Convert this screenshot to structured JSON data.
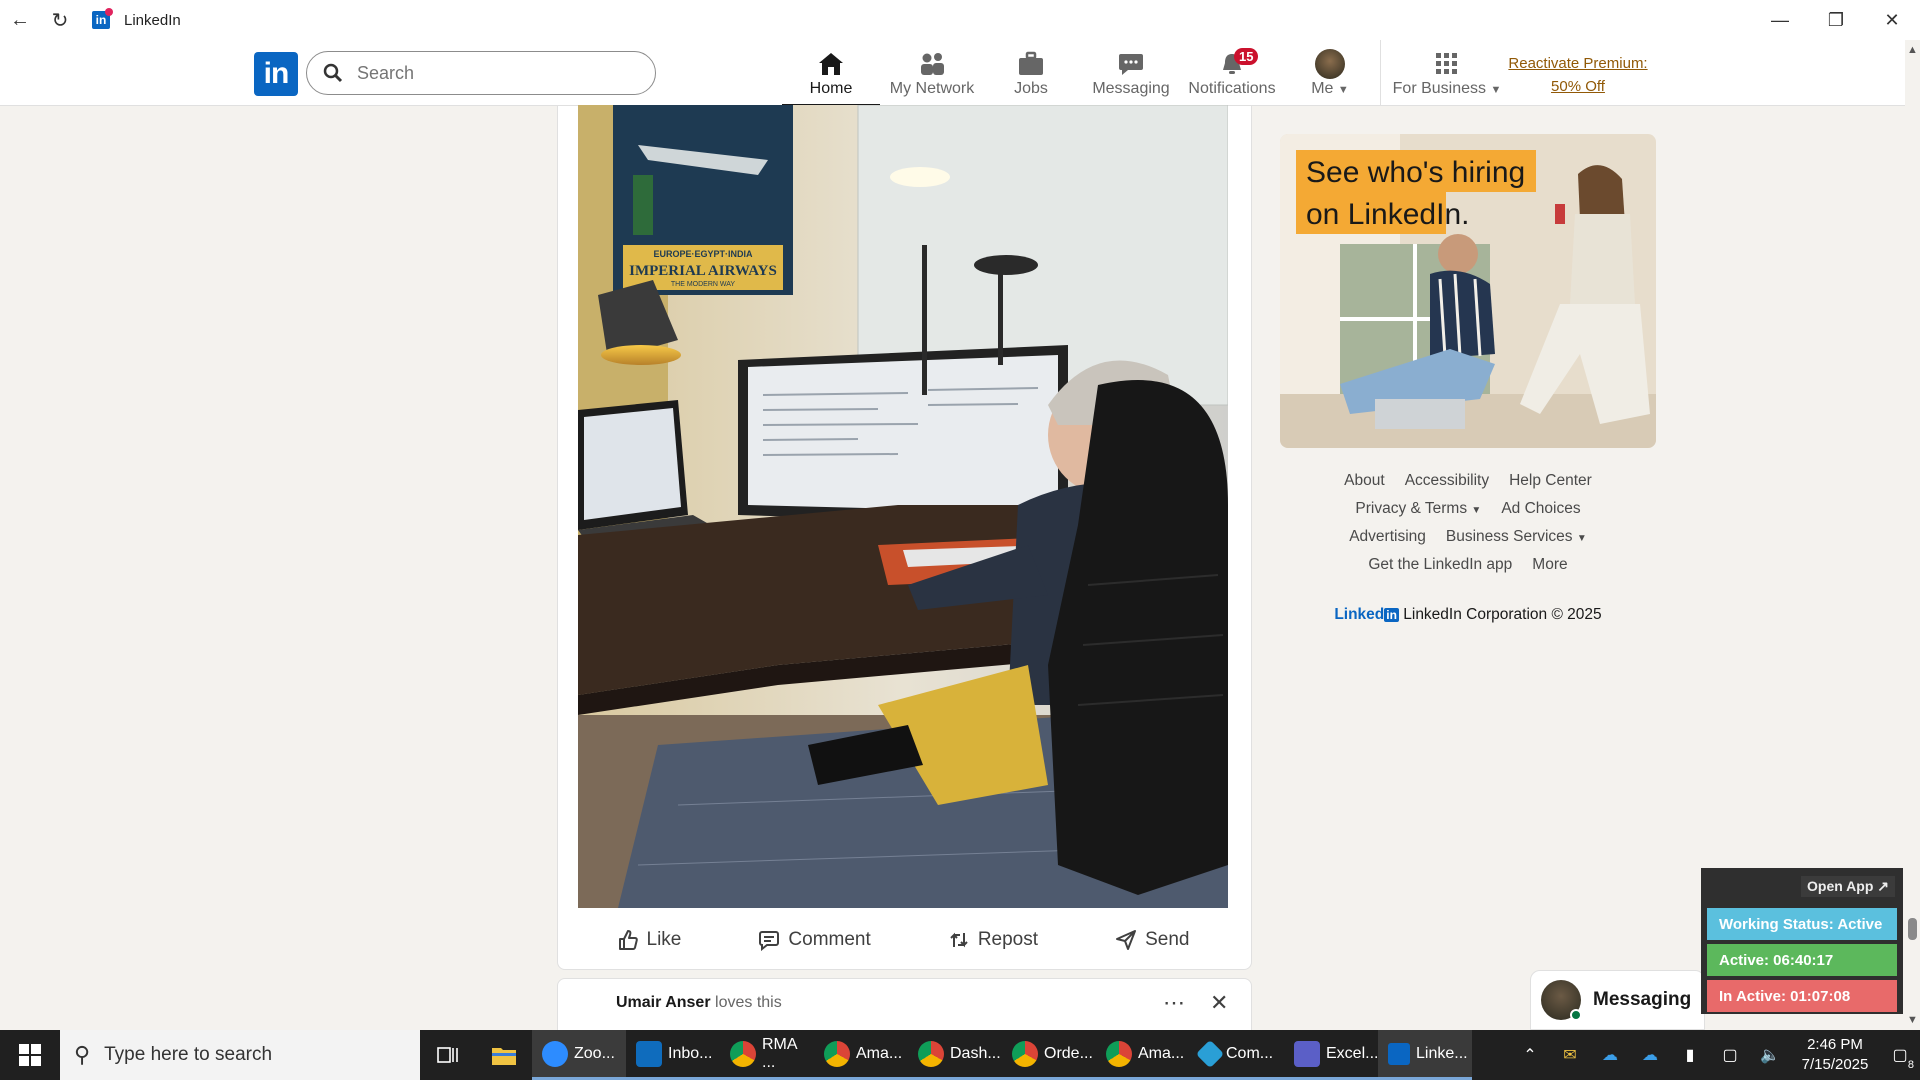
{
  "window": {
    "title": "LinkedIn"
  },
  "nav": {
    "search_placeholder": "Search",
    "items": [
      {
        "label": "Home"
      },
      {
        "label": "My Network"
      },
      {
        "label": "Jobs"
      },
      {
        "label": "Messaging"
      },
      {
        "label": "Notifications",
        "badge": "15"
      },
      {
        "label": "Me"
      },
      {
        "label": "For Business"
      }
    ],
    "premium_line1": "Reactivate Premium:",
    "premium_line2": "50% Off"
  },
  "post": {
    "actions": [
      {
        "label": "Like",
        "icon": "thumbs-up-icon"
      },
      {
        "label": "Comment",
        "icon": "comment-icon"
      },
      {
        "label": "Repost",
        "icon": "repost-icon"
      },
      {
        "label": "Send",
        "icon": "send-icon"
      }
    ],
    "image_text_poster_line1": "EUROPE·EGYPT·INDIA",
    "image_text_poster_line2": "IMPERIAL AIRWAYS",
    "image_text_poster_line3": "THE MODERN WAY"
  },
  "next_post": {
    "actor": "Umair Anser",
    "activity": "loves this"
  },
  "ad": {
    "line1": "See who's hiring",
    "line2": "on LinkedIn."
  },
  "footer": {
    "links_row1": [
      "About",
      "Accessibility",
      "Help Center"
    ],
    "links_row2": [
      "Privacy & Terms",
      "Ad Choices"
    ],
    "links_row3": [
      "Advertising",
      "Business Services"
    ],
    "links_row4": [
      "Get the LinkedIn app",
      "More"
    ],
    "brand": "Linked",
    "brand_in": "in",
    "copyright": "LinkedIn Corporation © 2025"
  },
  "messaging": {
    "label": "Messaging"
  },
  "status_widget": {
    "open_app": "Open App ↗",
    "working_status": "Working Status: Active",
    "active": "Active: 06:40:17",
    "inactive": "In Active: 01:07:08",
    "colors": {
      "working": "#5bc0de",
      "active": "#5cb85c",
      "inactive": "#e86a6a"
    }
  },
  "taskbar": {
    "search_placeholder": "Type here to search",
    "apps": [
      {
        "label": "Zoo...",
        "color": "#2d8cff"
      },
      {
        "label": "Inbo...",
        "color": "#0f6cbd"
      },
      {
        "label": "RMA ...",
        "color": "#db4437"
      },
      {
        "label": "Ama...",
        "color": "#db4437"
      },
      {
        "label": "Dash...",
        "color": "#db4437"
      },
      {
        "label": "Orde...",
        "color": "#db4437"
      },
      {
        "label": "Ama...",
        "color": "#db4437"
      },
      {
        "label": "Com...",
        "color": "#2a9fd6"
      },
      {
        "label": "Excel...",
        "color": "#5b5fc7"
      },
      {
        "label": "Linke...",
        "color": "#0a66c2"
      }
    ],
    "time": "2:46 PM",
    "date": "7/15/2025",
    "notification_count": "8"
  },
  "colors": {
    "linkedin_blue": "#0a66c2",
    "premium": "#915907",
    "badge": "#cb112d"
  }
}
